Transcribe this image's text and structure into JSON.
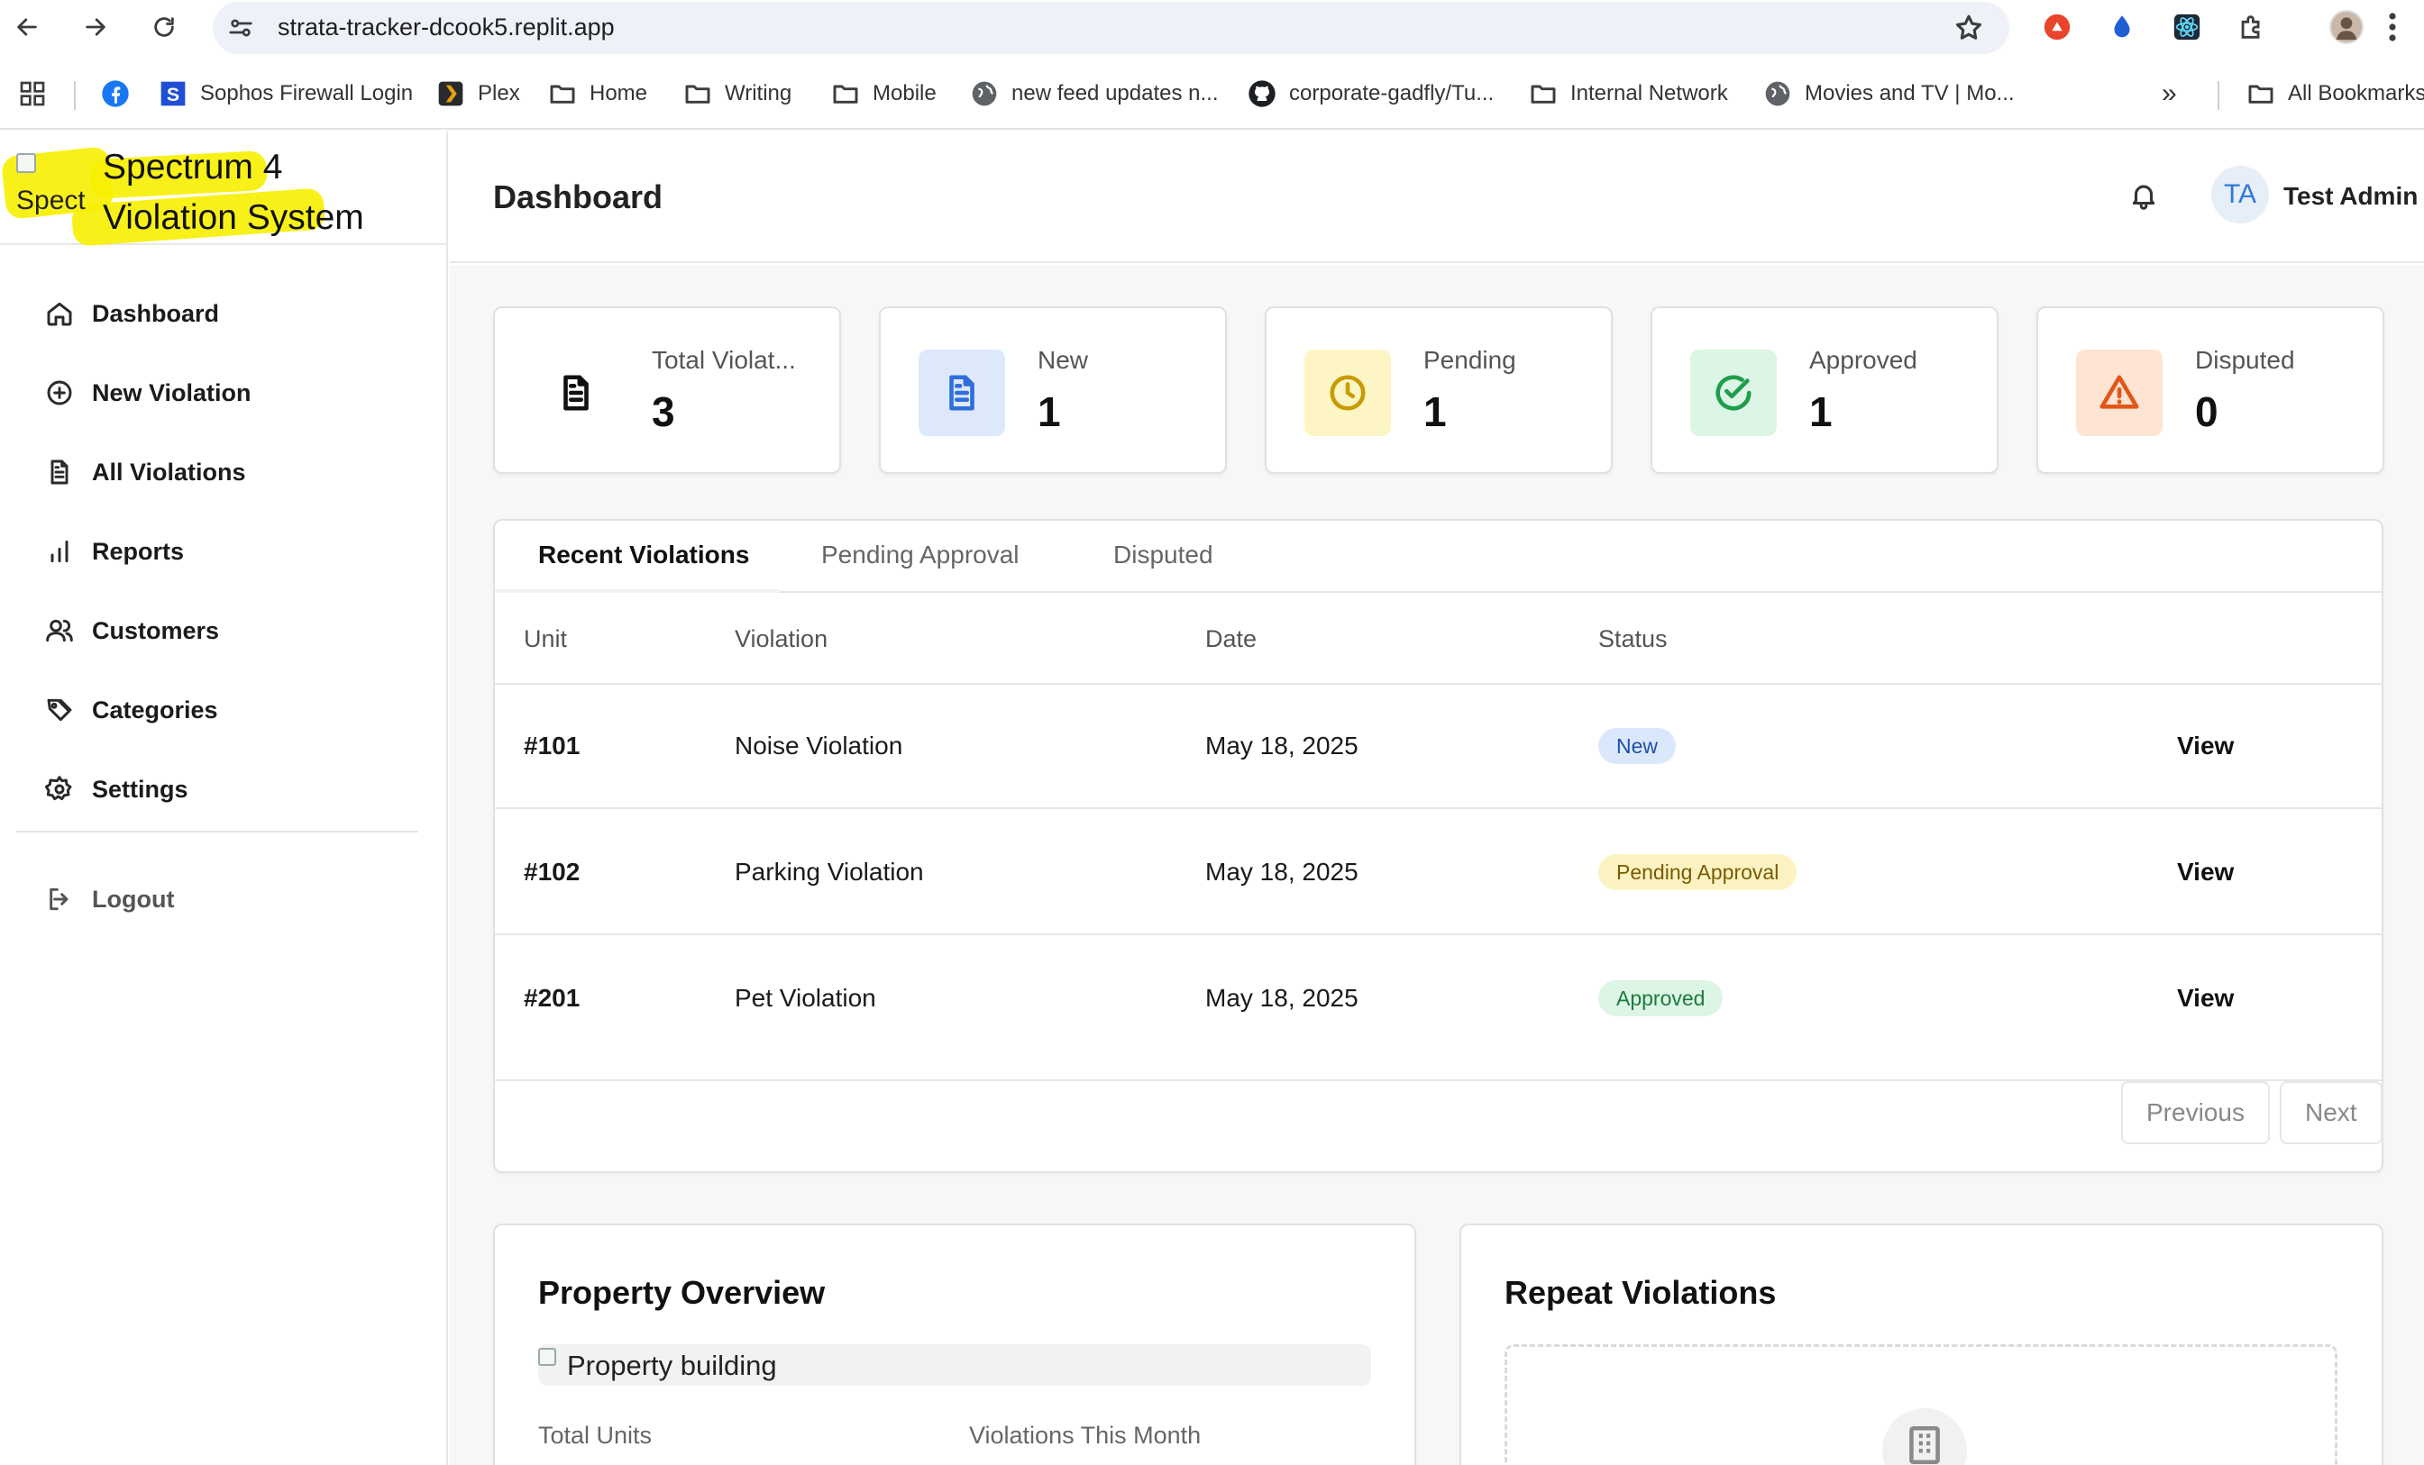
{
  "browser": {
    "url": "strata-tracker-dcook5.replit.app",
    "bookmarks": [
      {
        "label": "Sophos Firewall Login",
        "icon": "sophos-icon"
      },
      {
        "label": "Plex",
        "icon": "plex-icon"
      },
      {
        "label": "Home",
        "icon": "folder-icon"
      },
      {
        "label": "Writing",
        "icon": "folder-icon"
      },
      {
        "label": "Mobile",
        "icon": "folder-icon"
      },
      {
        "label": "new feed updates n...",
        "icon": "globe-icon"
      },
      {
        "label": "corporate-gadfly/Tu...",
        "icon": "github-icon"
      },
      {
        "label": "Internal Network",
        "icon": "folder-icon"
      },
      {
        "label": "Movies and TV | Mo...",
        "icon": "globe-icon"
      }
    ],
    "overflow_label": "»",
    "all_bookmarks_label": "All Bookmarks"
  },
  "brand": {
    "logo_alt": "Spect",
    "name_line1": "Spectrum 4",
    "name_line2": "Violation System",
    "highlight_color": "#f7f000"
  },
  "sidebar": {
    "items": [
      {
        "label": "Dashboard",
        "icon": "home-icon"
      },
      {
        "label": "New Violation",
        "icon": "plus-circle-icon"
      },
      {
        "label": "All Violations",
        "icon": "file-text-icon"
      },
      {
        "label": "Reports",
        "icon": "bar-chart-icon"
      },
      {
        "label": "Customers",
        "icon": "users-icon"
      },
      {
        "label": "Categories",
        "icon": "tags-icon"
      },
      {
        "label": "Settings",
        "icon": "gear-icon"
      }
    ],
    "logout_label": "Logout"
  },
  "header": {
    "title": "Dashboard",
    "avatar_initials": "TA",
    "user_name": "Test Admin"
  },
  "stats": [
    {
      "label": "Total Violat...",
      "value": "3",
      "icon": "file-text-icon",
      "color": "#111111",
      "bg": "#ffffff"
    },
    {
      "label": "New",
      "value": "1",
      "icon": "file-text-icon",
      "color": "#2f6fdb",
      "bg": "#dde9fb"
    },
    {
      "label": "Pending",
      "value": "1",
      "icon": "clock-icon",
      "color": "#c99a06",
      "bg": "#fdf5c4"
    },
    {
      "label": "Approved",
      "value": "1",
      "icon": "check-circle-icon",
      "color": "#1f9d4c",
      "bg": "#dcf5e4"
    },
    {
      "label": "Disputed",
      "value": "0",
      "icon": "warning-icon",
      "color": "#e2561a",
      "bg": "#fde4d3"
    }
  ],
  "tabs": [
    "Recent Violations",
    "Pending Approval",
    "Disputed"
  ],
  "table": {
    "headers": [
      "Unit",
      "Violation",
      "Date",
      "Status"
    ],
    "rows": [
      {
        "unit": "#101",
        "violation": "Noise Violation",
        "date": "May 18, 2025",
        "status": "New",
        "status_bg": "#dbe8fb",
        "status_color": "#1e4fa8",
        "action": "View"
      },
      {
        "unit": "#102",
        "violation": "Parking Violation",
        "date": "May 18, 2025",
        "status": "Pending Approval",
        "status_bg": "#fdf3c2",
        "status_color": "#7a5a00",
        "action": "View"
      },
      {
        "unit": "#201",
        "violation": "Pet Violation",
        "date": "May 18, 2025",
        "status": "Approved",
        "status_bg": "#dcf5e4",
        "status_color": "#1b7a3c",
        "action": "View"
      }
    ]
  },
  "pagination": {
    "previous": "Previous",
    "next": "Next"
  },
  "property_overview": {
    "title": "Property Overview",
    "image_alt": "Property building",
    "total_units_label": "Total Units",
    "violations_month_label": "Violations This Month"
  },
  "repeat_violations": {
    "title": "Repeat Violations",
    "empty_icon": "building-icon"
  }
}
